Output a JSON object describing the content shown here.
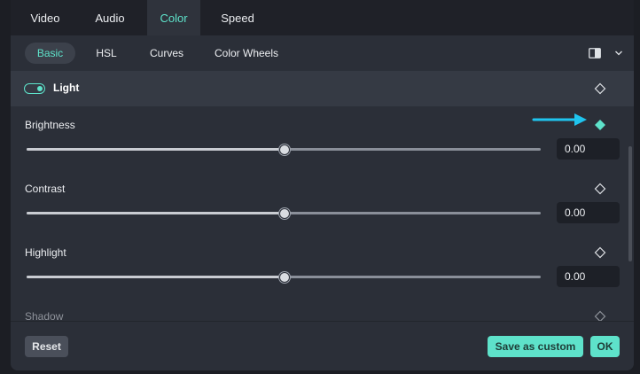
{
  "top_tabs": [
    {
      "label": "Video"
    },
    {
      "label": "Audio"
    },
    {
      "label": "Color"
    },
    {
      "label": "Speed"
    }
  ],
  "active_top_tab": "Color",
  "sub_tabs": [
    {
      "label": "Basic"
    },
    {
      "label": "HSL"
    },
    {
      "label": "Curves"
    },
    {
      "label": "Color Wheels"
    }
  ],
  "active_sub_tab": "Basic",
  "section": {
    "title": "Light",
    "enabled": true
  },
  "adjustments": [
    {
      "label": "Brightness",
      "value": "0.00",
      "slider_fraction": 0.5,
      "keyframe_active": true
    },
    {
      "label": "Contrast",
      "value": "0.00",
      "slider_fraction": 0.5,
      "keyframe_active": false
    },
    {
      "label": "Highlight",
      "value": "0.00",
      "slider_fraction": 0.5,
      "keyframe_active": false
    },
    {
      "label": "Shadow",
      "keyframe_active": false
    }
  ],
  "footer": {
    "reset_label": "Reset",
    "save_label": "Save as custom",
    "ok_label": "OK"
  },
  "colors": {
    "accent": "#5ee2ca",
    "panel": "#2b2f38",
    "annotation_arrow": "#1fc4ee"
  },
  "icons": {
    "layout": "split-view-icon",
    "dropdown": "chevron-down-icon",
    "keyframe": "diamond-icon"
  }
}
